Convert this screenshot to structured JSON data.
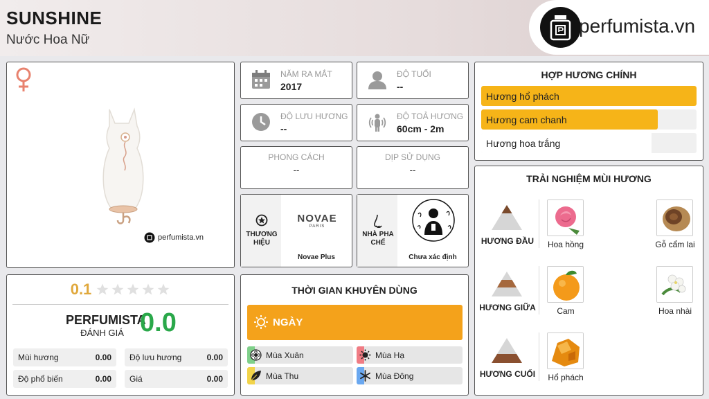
{
  "header": {
    "title": "SUNSHINE",
    "subtitle": "Nước Hoa Nữ",
    "logo_text": "perfumista.vn"
  },
  "product": {
    "gender_icon": "female-symbol-icon",
    "watermark": "perfumista.vn"
  },
  "rating": {
    "user_score": "0.1",
    "stars_filled": 0,
    "stars_total": 5,
    "perfumista_label": "PERFUMISTA",
    "perfumista_sub": "ĐÁNH GIÁ",
    "perfumista_score": "0.0",
    "metrics": [
      {
        "label": "Mùi hương",
        "value": "0.00"
      },
      {
        "label": "Độ lưu hương",
        "value": "0.00"
      },
      {
        "label": "Độ phổ biến",
        "value": "0.00"
      },
      {
        "label": "Giá",
        "value": "0.00"
      }
    ]
  },
  "info": {
    "release": {
      "label": "NĂM RA MẮT",
      "value": "2017",
      "icon": "calendar-icon"
    },
    "age": {
      "label": "ĐỘ TUỔI",
      "value": "--",
      "icon": "person-icon"
    },
    "longevity": {
      "label": "ĐỘ LƯU HƯƠNG",
      "value": "--",
      "icon": "clock-icon"
    },
    "sillage": {
      "label": "ĐỘ TOẢ HƯƠNG",
      "value": "60cm - 2m",
      "icon": "sillage-icon"
    },
    "style": {
      "label": "PHONG CÁCH",
      "value": "--"
    },
    "occasion": {
      "label": "DỊP SỬ DỤNG",
      "value": "--"
    },
    "brand": {
      "label": "THƯƠNG HIỆU",
      "logo_text": "NOVAE",
      "logo_sub": "PARIS",
      "name": "Novae Plus",
      "icon": "star-icon"
    },
    "perfumer": {
      "label": "NHÀ PHA CHẾ",
      "name": "Chưa xác định",
      "icon": "nose-icon"
    }
  },
  "time": {
    "title": "THỜI GIAN KHUYÊN DÙNG",
    "day_label": "NGÀY",
    "day_level": 1.0,
    "seasons": [
      {
        "label": "Mùa Xuân",
        "icon": "spring-flower-icon",
        "color": "#7fd08a"
      },
      {
        "label": "Mùa Hạ",
        "icon": "sun-icon",
        "color": "#f07c84"
      },
      {
        "label": "Mùa Thu",
        "icon": "leaf-icon",
        "color": "#f2d44a"
      },
      {
        "label": "Mùa Đông",
        "icon": "snowflake-icon",
        "color": "#6aa8f0"
      }
    ]
  },
  "accords": {
    "title": "HỢP HƯƠNG CHÍNH",
    "items": [
      {
        "label": "Hương hổ phách",
        "level": 1.0
      },
      {
        "label": "Hương cam chanh",
        "level": 0.82
      },
      {
        "label": "Hương hoa trắng",
        "level": 0.0
      }
    ]
  },
  "notes": {
    "title": "TRẢI NGHIỆM MÙI HƯƠNG",
    "top": {
      "label": "HƯƠNG ĐẦU",
      "items": [
        "Hoa hồng",
        "Gỗ cẩm lai"
      ]
    },
    "middle": {
      "label": "HƯƠNG GIỮA",
      "items": [
        "Cam",
        "Hoa nhài"
      ]
    },
    "base": {
      "label": "HƯƠNG CUỐI",
      "items": [
        "Hổ phách"
      ]
    }
  },
  "colors": {
    "accent_orange": "#f4a21b",
    "accord_yellow": "#f6b418",
    "score_green": "#2aa84a",
    "rating_gold": "#e0a83c"
  }
}
